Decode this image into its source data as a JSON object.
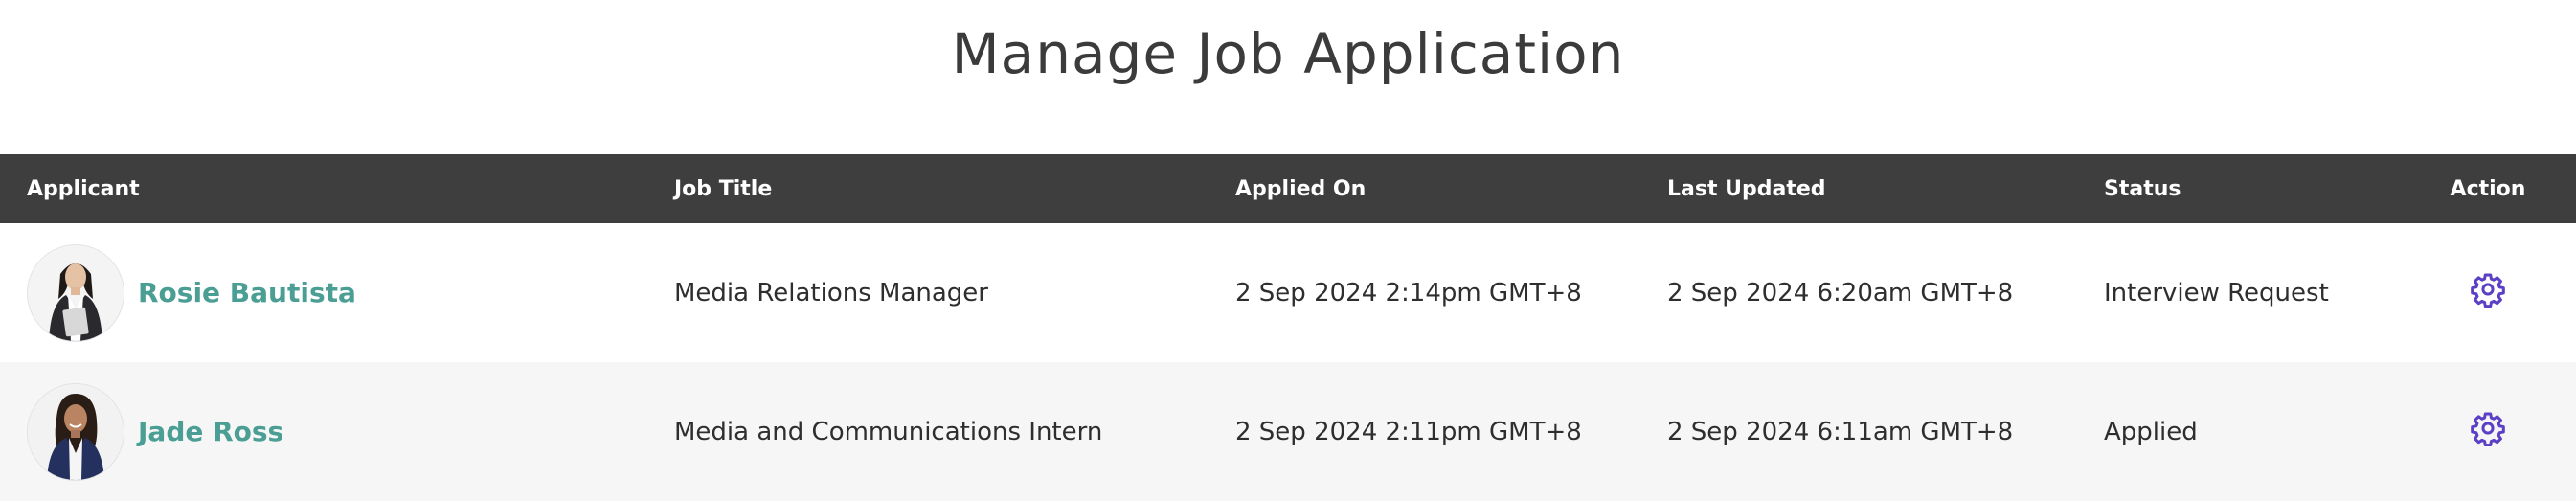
{
  "page": {
    "title": "Manage Job Application"
  },
  "table": {
    "headers": {
      "applicant": "Applicant",
      "job_title": "Job Title",
      "applied_on": "Applied On",
      "last_updated": "Last Updated",
      "status": "Status",
      "action": "Action"
    },
    "rows": [
      {
        "applicant": "Rosie Bautista",
        "job_title": "Media Relations Manager",
        "applied_on": "2 Sep 2024 2:14pm GMT+8",
        "last_updated": "2 Sep 2024 6:20am GMT+8",
        "status": "Interview Request",
        "action_icon": "gear-icon"
      },
      {
        "applicant": "Jade Ross",
        "job_title": "Media and Communications Intern",
        "applied_on": "2 Sep 2024 2:11pm GMT+8",
        "last_updated": "2 Sep 2024 6:11am GMT+8",
        "status": "Applied",
        "action_icon": "gear-icon"
      }
    ]
  },
  "colors": {
    "header_bg": "#3e3e3e",
    "applicant_name": "#4a9e94",
    "action_icon": "#5b3fc4",
    "alt_row_bg": "#f6f6f6"
  }
}
